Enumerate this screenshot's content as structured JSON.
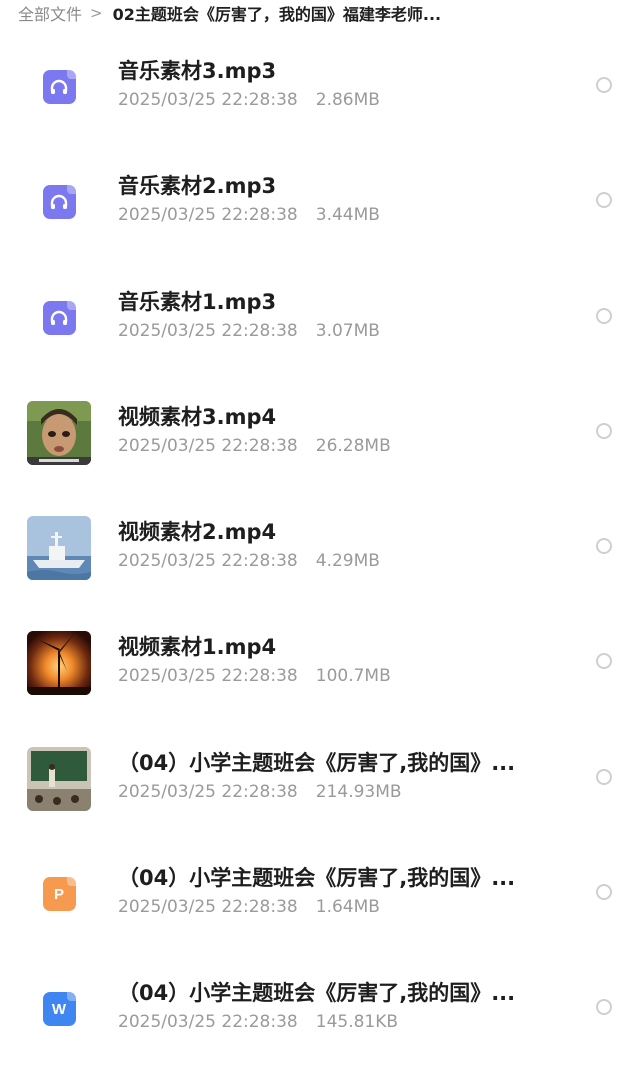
{
  "breadcrumb": {
    "root": "全部文件",
    "separator": ">",
    "current": "02主题班会《厉害了，我的国》福建李老师..."
  },
  "colors": {
    "audio_icon": "#7b78f0",
    "ppt_icon": "#f59a4e",
    "word_icon": "#3f86f0",
    "meta_text": "#9a9a9a"
  },
  "files": [
    {
      "name": "音乐素材3.mp3",
      "date": "2025/03/25 22:28:38",
      "size": "2.86MB",
      "icon": "headphones-icon"
    },
    {
      "name": "音乐素材2.mp3",
      "date": "2025/03/25 22:28:38",
      "size": "3.44MB",
      "icon": "headphones-icon"
    },
    {
      "name": "音乐素材1.mp3",
      "date": "2025/03/25 22:28:38",
      "size": "3.07MB",
      "icon": "headphones-icon"
    },
    {
      "name": "视频素材3.mp4",
      "date": "2025/03/25 22:28:38",
      "size": "26.28MB",
      "icon": "video-thumbnail-child-face"
    },
    {
      "name": "视频素材2.mp4",
      "date": "2025/03/25 22:28:38",
      "size": "4.29MB",
      "icon": "video-thumbnail-warship"
    },
    {
      "name": "视频素材1.mp4",
      "date": "2025/03/25 22:28:38",
      "size": "100.7MB",
      "icon": "video-thumbnail-wind-turbine-sunset"
    },
    {
      "name": "（04）小学主题班会《厉害了,我的国》...",
      "date": "2025/03/25 22:28:38",
      "size": "214.93MB",
      "icon": "video-thumbnail-classroom"
    },
    {
      "name": "（04）小学主题班会《厉害了,我的国》...",
      "date": "2025/03/25 22:28:38",
      "size": "1.64MB",
      "icon": "ppt-icon",
      "icon_letter": "P"
    },
    {
      "name": "（04）小学主题班会《厉害了,我的国》...",
      "date": "2025/03/25 22:28:38",
      "size": "145.81KB",
      "icon": "word-icon",
      "icon_letter": "W"
    }
  ]
}
